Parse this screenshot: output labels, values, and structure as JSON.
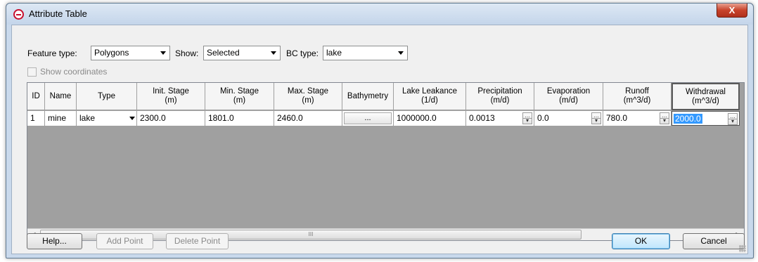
{
  "window": {
    "title": "Attribute Table",
    "close_label": "X"
  },
  "toolbar": {
    "feature_type_label": "Feature type:",
    "feature_type_value": "Polygons",
    "show_label": "Show:",
    "show_value": "Selected",
    "bc_type_label": "BC type:",
    "bc_type_value": "lake",
    "show_coordinates_label": "Show coordinates"
  },
  "table": {
    "headers": [
      "ID",
      "Name",
      "Type",
      "Init. Stage\n(m)",
      "Min. Stage\n(m)",
      "Max. Stage\n(m)",
      "Bathymetry",
      "Lake Leakance\n(1/d)",
      "Precipitation\n(m/d)",
      "Evaporation\n(m/d)",
      "Runoff\n(m^3/d)",
      "Withdrawal\n(m^3/d)"
    ],
    "row": {
      "id": "1",
      "name": "mine",
      "type": "lake",
      "init_stage": "2300.0",
      "min_stage": "1801.0",
      "max_stage": "2460.0",
      "bathymetry": "...",
      "lake_leakance": "1000000.0",
      "precipitation": "0.0013",
      "evaporation": "0.0",
      "runoff": "780.0",
      "withdrawal": "2000.0"
    }
  },
  "buttons": {
    "help": "Help...",
    "add_point": "Add Point",
    "delete_point": "Delete Point",
    "ok": "OK",
    "cancel": "Cancel"
  }
}
